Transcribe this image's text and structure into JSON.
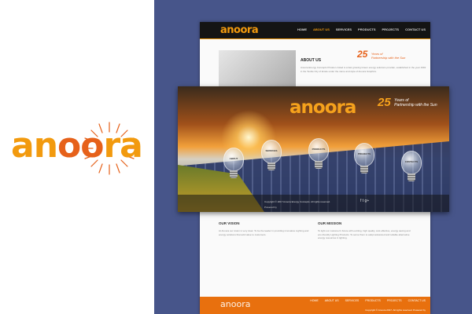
{
  "brand": {
    "name_main": "an",
    "name_accent": "oo",
    "name_end": "ra",
    "colors": {
      "orange": "#f29a0e",
      "red_orange": "#e6611a",
      "slate": "#47558a"
    }
  },
  "site": {
    "nav": [
      "HOME",
      "ABOUT US",
      "SERVICES",
      "PRODUCTS",
      "PROJECTS",
      "CONTACT US"
    ],
    "active_nav": "ABOUT US",
    "tagline_number": "25",
    "tagline_line1": "Years of",
    "tagline_line2": "Partnership with the Sun",
    "about_title": "ABOUT US",
    "about_text": "Anoora Energy Concepts Private Limited is a fast growing Green energy solutions provider, established in the year 1992 in the Textile City of Erode under the name and style of Anoora Graphics.",
    "vision_title": "OUR VISION",
    "mission_title": "OUR MISSION",
    "vision_text": "At Anoora our vision is very clear. To be the leader in providing innovative Lighting and energy solutions that add value to customers.",
    "mission_text": "To light our customer's future with exciting, high quality, cost effective, energy saving and eco-friendly Lighting Products. To serve them to adopt advanced and reliable alternative energy resources in lighting.",
    "footer_nav": [
      "HOME",
      "ABOUT US",
      "SERVICES",
      "PRODUCTS",
      "PROJECTS",
      "CONTACT US"
    ],
    "footer_copy": "Copyright © Anoora 2017. All rights reserved. Powered by"
  },
  "banner": {
    "tagline_number": "25",
    "tagline_line1": "Years of",
    "tagline_line2": "Partnership with the Sun",
    "bulbs": [
      "ABOUT",
      "SERVICES",
      "PRODUCTS",
      "PROJECTS",
      "CONTACTS"
    ],
    "copyright": "Copyright © 2017 Anoora Energy Concepts. All rights reserved.",
    "social": "f  t  g+",
    "powered": "Powered by"
  }
}
